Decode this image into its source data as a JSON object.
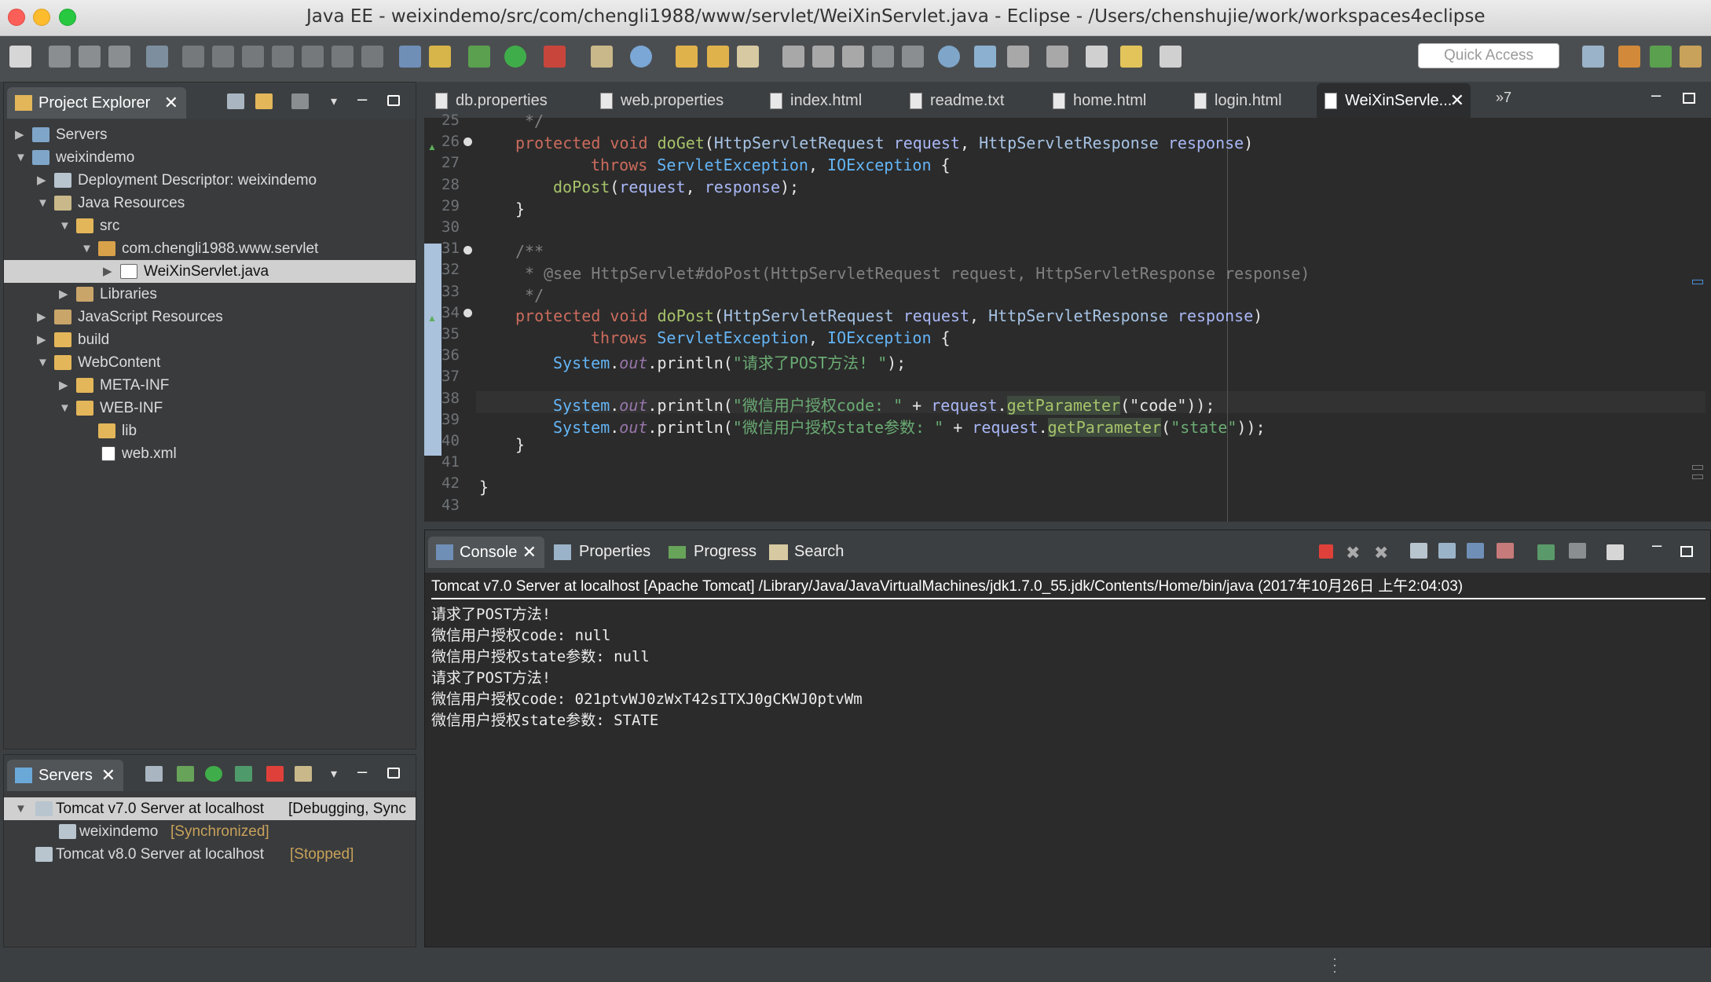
{
  "window": {
    "title": "Java EE - weixindemo/src/com/chengli1988/www/servlet/WeiXinServlet.java - Eclipse - /Users/chenshujie/work/workspaces4eclipse"
  },
  "toolbar": {
    "quick_access_placeholder": "Quick Access"
  },
  "project_explorer": {
    "tab_label": "Project Explorer",
    "tree": [
      {
        "label": "Servers"
      },
      {
        "label": "weixindemo"
      },
      {
        "label": "Deployment Descriptor: weixindemo"
      },
      {
        "label": "Java Resources"
      },
      {
        "label": "src"
      },
      {
        "label": "com.chengli1988.www.servlet"
      },
      {
        "label": "WeiXinServlet.java"
      },
      {
        "label": "Libraries"
      },
      {
        "label": "JavaScript Resources"
      },
      {
        "label": "build"
      },
      {
        "label": "WebContent"
      },
      {
        "label": "META-INF"
      },
      {
        "label": "WEB-INF"
      },
      {
        "label": "lib"
      },
      {
        "label": "web.xml"
      }
    ]
  },
  "servers_view": {
    "tab_label": "Servers",
    "items": [
      {
        "label": "Tomcat v7.0 Server at localhost",
        "status": "[Debugging, Sync"
      },
      {
        "label": "weixindemo",
        "status": "[Synchronized]"
      },
      {
        "label": "Tomcat v8.0 Server at localhost",
        "status": "[Stopped]"
      }
    ]
  },
  "editor": {
    "tabs": [
      {
        "label": "db.properties"
      },
      {
        "label": "web.properties"
      },
      {
        "label": "index.html"
      },
      {
        "label": "readme.txt"
      },
      {
        "label": "home.html"
      },
      {
        "label": "login.html"
      },
      {
        "label": "WeiXinServle..."
      }
    ],
    "overflow_label": "»7",
    "line_numbers": [
      "25",
      "26",
      "27",
      "28",
      "29",
      "30",
      "31",
      "32",
      "33",
      "34",
      "35",
      "36",
      "37",
      "38",
      "39",
      "40",
      "41",
      "42",
      "43"
    ],
    "code": {
      "l25": "*/",
      "l26_kw": "protected void ",
      "l26_fn": "doGet",
      "l26_p1": "(",
      "l26_t1": "HttpServletRequest ",
      "l26_v1": "request",
      "l26_p2": ", ",
      "l26_t2": "HttpServletResponse ",
      "l26_v2": "response",
      "l26_p3": ")",
      "l27_kw": "throws ",
      "l27_t1": "ServletException",
      "l27_p1": ", ",
      "l27_t2": "IOException",
      "l27_p2": " {",
      "l28_fn": "doPost",
      "l28_p1": "(",
      "l28_v1": "request",
      "l28_p2": ", ",
      "l28_v2": "response",
      "l28_p3": ");",
      "l29": "}",
      "l31": "/**",
      "l32": " * @see HttpServlet#doPost(HttpServletRequest request, HttpServletResponse response)",
      "l33": " */",
      "l34_kw": "protected void ",
      "l34_fn": "doPost",
      "l34_p1": "(",
      "l34_t1": "HttpServletRequest ",
      "l34_v1": "request",
      "l34_p2": ", ",
      "l34_t2": "HttpServletResponse ",
      "l34_v2": "response",
      "l34_p3": ")",
      "l35_kw": "throws ",
      "l35_t1": "ServletException",
      "l35_p1": ", ",
      "l35_t2": "IOException",
      "l35_p2": " {",
      "sys": "System",
      "dot": ".",
      "out": "out",
      "println": "println(",
      "l36_str": "\"请求了POST方法! \"",
      "l36_end": ");",
      "l38_str": "\"微信用户授权code: \"",
      "plus": " + ",
      "req": "request",
      "getp": "getParameter",
      "l38_arg": "(\"code\"));",
      "l39_str": "\"微信用户授权state参数: \"",
      "l39_arg_open": "(",
      "l39_arg_str": "\"state\"",
      "l39_arg_close": "));",
      "l40": "}",
      "l42": "}"
    }
  },
  "console": {
    "tabs": [
      {
        "label": "Console"
      },
      {
        "label": "Properties"
      },
      {
        "label": "Progress"
      },
      {
        "label": "Search"
      }
    ],
    "description": "Tomcat v7.0 Server at localhost [Apache Tomcat] /Library/Java/JavaVirtualMachines/jdk1.7.0_55.jdk/Contents/Home/bin/java (2017年10月26日 上午2:04:03)",
    "lines": [
      "请求了POST方法!",
      "微信用户授权code: null",
      "微信用户授权state参数: null",
      "请求了POST方法!",
      "微信用户授权code: 021ptvWJ0zWxT42sITXJ0gCKWJ0ptvWm",
      "微信用户授权state参数: STATE"
    ]
  }
}
